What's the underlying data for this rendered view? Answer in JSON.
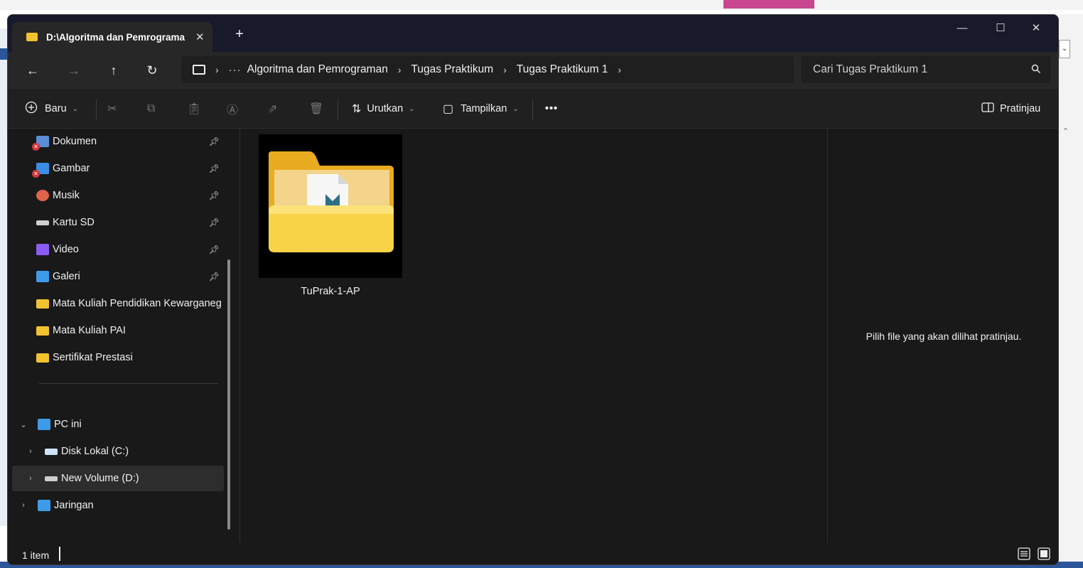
{
  "window": {
    "tab_title": "D:\\Algoritma dan Pemrograma",
    "new_tab_label": "+",
    "tab_close_label": "✕",
    "minimize_label": "—",
    "maximize_label": "☐",
    "close_label": "✕"
  },
  "address": {
    "breadcrumbs": [
      "Algoritma dan Pemrograman",
      "Tugas Praktikum",
      "Tugas Praktikum 1"
    ],
    "ellipsis": "···",
    "search_placeholder": "Cari Tugas Praktikum 1"
  },
  "toolbar": {
    "new_label": "Baru",
    "sort_label": "Urutkan",
    "view_label": "Tampilkan",
    "more_label": "•••",
    "preview_label": "Pratinjau"
  },
  "sidebar": {
    "quick_access": [
      {
        "label": "Dokumen",
        "icon": "documents-icon",
        "pinned": true,
        "error": true
      },
      {
        "label": "Gambar",
        "icon": "pictures-icon",
        "pinned": true,
        "error": true
      },
      {
        "label": "Musik",
        "icon": "music-icon",
        "pinned": true
      },
      {
        "label": "Kartu SD",
        "icon": "sd-card-icon",
        "pinned": true
      },
      {
        "label": "Video",
        "icon": "video-icon",
        "pinned": true
      },
      {
        "label": "Galeri",
        "icon": "gallery-icon",
        "pinned": true
      },
      {
        "label": "Mata Kuliah Pendidikan Kewarganegaraan",
        "icon": "folder-icon"
      },
      {
        "label": "Mata Kuliah PAI",
        "icon": "folder-icon"
      },
      {
        "label": "Sertifikat Prestasi",
        "icon": "folder-icon"
      }
    ],
    "tree": [
      {
        "label": "PC ini",
        "icon": "pc-icon",
        "expanded": true
      },
      {
        "label": "Disk Lokal (C:)",
        "icon": "local-disk-icon"
      },
      {
        "label": "New Volume (D:)",
        "icon": "drive-icon",
        "selected": true
      },
      {
        "label": "Jaringan",
        "icon": "network-icon"
      }
    ]
  },
  "content": {
    "files": [
      {
        "name": "TuPrak-1-AP",
        "type": "folder-with-document"
      }
    ]
  },
  "preview": {
    "empty_message": "Pilih file yang akan dilihat pratinjau."
  },
  "status": {
    "item_count": "1 item"
  },
  "colors": {
    "window_bg": "#191919",
    "titlebar_bg": "#181a2b",
    "folder_yellow": "#f2c230",
    "selected_bg": "#2d2d2d"
  }
}
